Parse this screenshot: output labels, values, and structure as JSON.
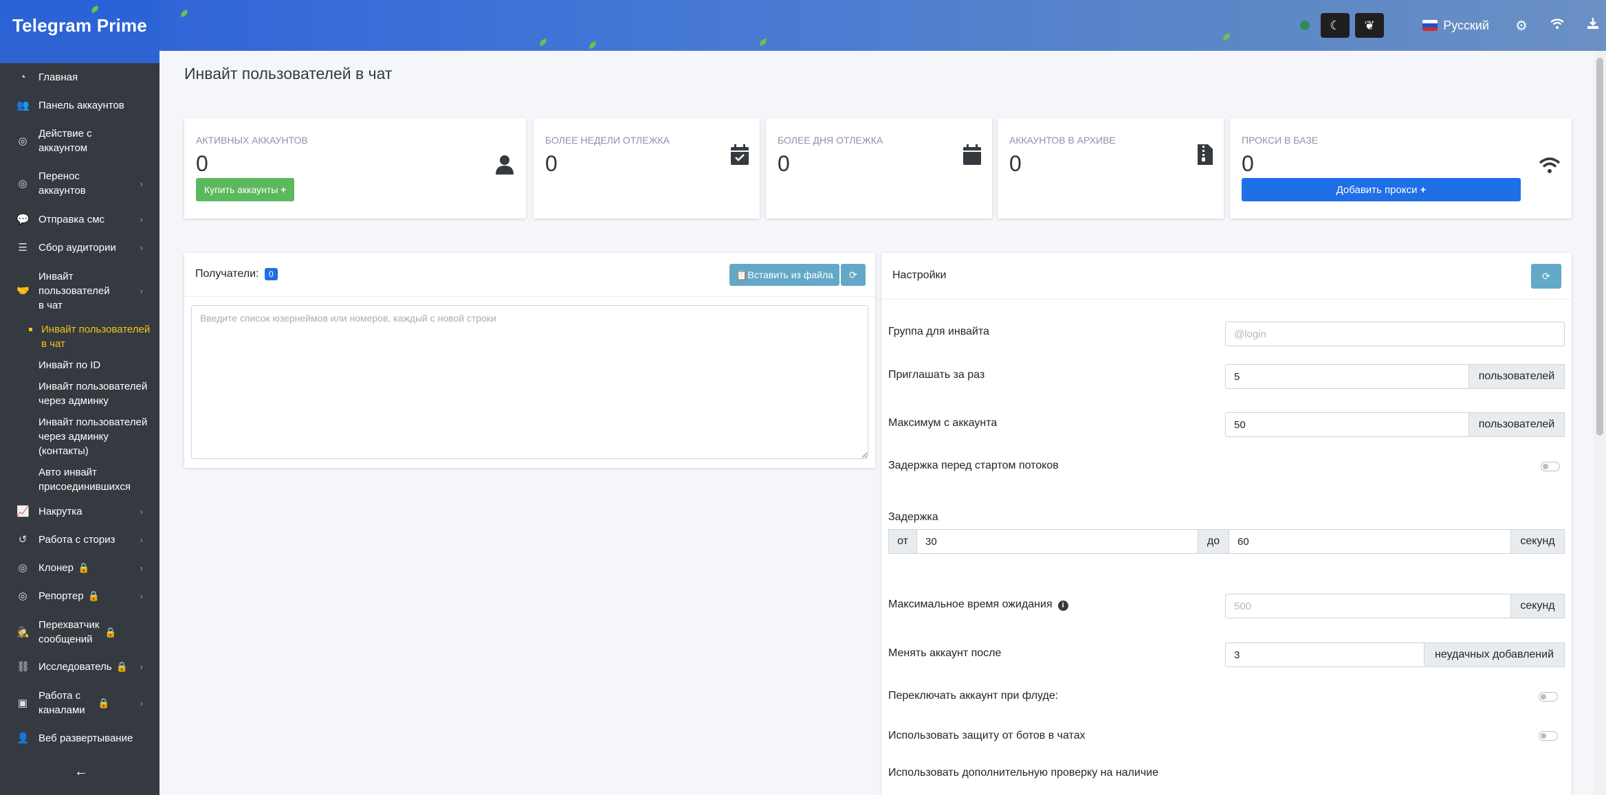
{
  "app": {
    "brand": "Telegram Prime",
    "language": "Русский"
  },
  "sidebar": {
    "items": [
      {
        "label": "Главная",
        "icon": "dashboard-icon"
      },
      {
        "label": "Панель аккаунтов",
        "icon": "users-icon"
      },
      {
        "label": "Действие с аккаунтом",
        "icon": "user-circle-icon"
      },
      {
        "label": "Перенос аккаунтов",
        "icon": "user-circle-icon"
      },
      {
        "label": "Отправка смс",
        "icon": "comments-icon"
      },
      {
        "label": "Сбор аудитории",
        "icon": "database-icon"
      },
      {
        "label": "Инвайт пользователей в чат",
        "icon": "handshake-icon"
      },
      {
        "label": "Накрутка",
        "icon": "chart-icon"
      },
      {
        "label": "Работа с сториз",
        "icon": "history-icon"
      },
      {
        "label": "Клонер",
        "icon": "user-circle-icon"
      },
      {
        "label": "Репортер",
        "icon": "user-circle-icon"
      },
      {
        "label": "Перехватчик сообщений",
        "icon": "user-secret-icon"
      },
      {
        "label": "Исследователь",
        "icon": "sitemap-icon"
      },
      {
        "label": "Работа с каналами",
        "icon": "address-book-icon"
      },
      {
        "label": "Веб развертывание аккаунта",
        "icon": "user-icon"
      }
    ],
    "subitems": [
      "Инвайт пользователей в чат",
      "Инвайт по ID",
      "Инвайт пользователей через админку",
      "Инвайт пользователей через админку (контакты)",
      "Авто инвайт присоединившихся"
    ]
  },
  "page": {
    "title": "Инвайт пользователей в чат"
  },
  "stats": [
    {
      "label": "Активных аккаунтов",
      "value": "0",
      "button": "Купить аккаунты",
      "icon": "user-icon"
    },
    {
      "label": "Более недели отлежка",
      "value": "0",
      "icon": "calendar-check-icon"
    },
    {
      "label": "Более дня отлежка",
      "value": "0",
      "icon": "calendar-icon"
    },
    {
      "label": "Аккаунтов в архиве",
      "value": "0",
      "icon": "file-zip-icon"
    },
    {
      "label": "Прокси в базе",
      "value": "0",
      "button": "Добавить прокси",
      "icon": "wifi-icon"
    }
  ],
  "recipients": {
    "title": "Получатели:",
    "count": "0",
    "paste_button": "Вставить из файла",
    "placeholder": "Введите список юзернеймов или номеров, каждый с новой строки"
  },
  "settings": {
    "title": "Настройки",
    "group_label": "Группа для инвайта",
    "group_placeholder": "@login",
    "per_batch_label": "Приглашать за раз",
    "per_batch_value": "5",
    "per_batch_unit": "пользователей",
    "max_per_account_label": "Максимум с аккаунта",
    "max_per_account_value": "50",
    "max_per_account_unit": "пользователей",
    "start_delay_label": "Задержка перед стартом потоков",
    "delay_label": "Задержка",
    "delay_from_label": "от",
    "delay_from_value": "30",
    "delay_to_label": "до",
    "delay_to_value": "60",
    "delay_unit": "секунд",
    "max_wait_label": "Максимальное время ожидания",
    "max_wait_placeholder": "500",
    "max_wait_unit": "секунд",
    "switch_after_label": "Менять аккаунт после",
    "switch_after_value": "3",
    "switch_after_unit": "неудачных добавлений",
    "flood_switch_label": "Переключать аккаунт при флуде:",
    "bot_protection_label": "Использовать защиту от ботов в чатах",
    "extra_check_label": "Использовать дополнительную проверку на наличие"
  }
}
